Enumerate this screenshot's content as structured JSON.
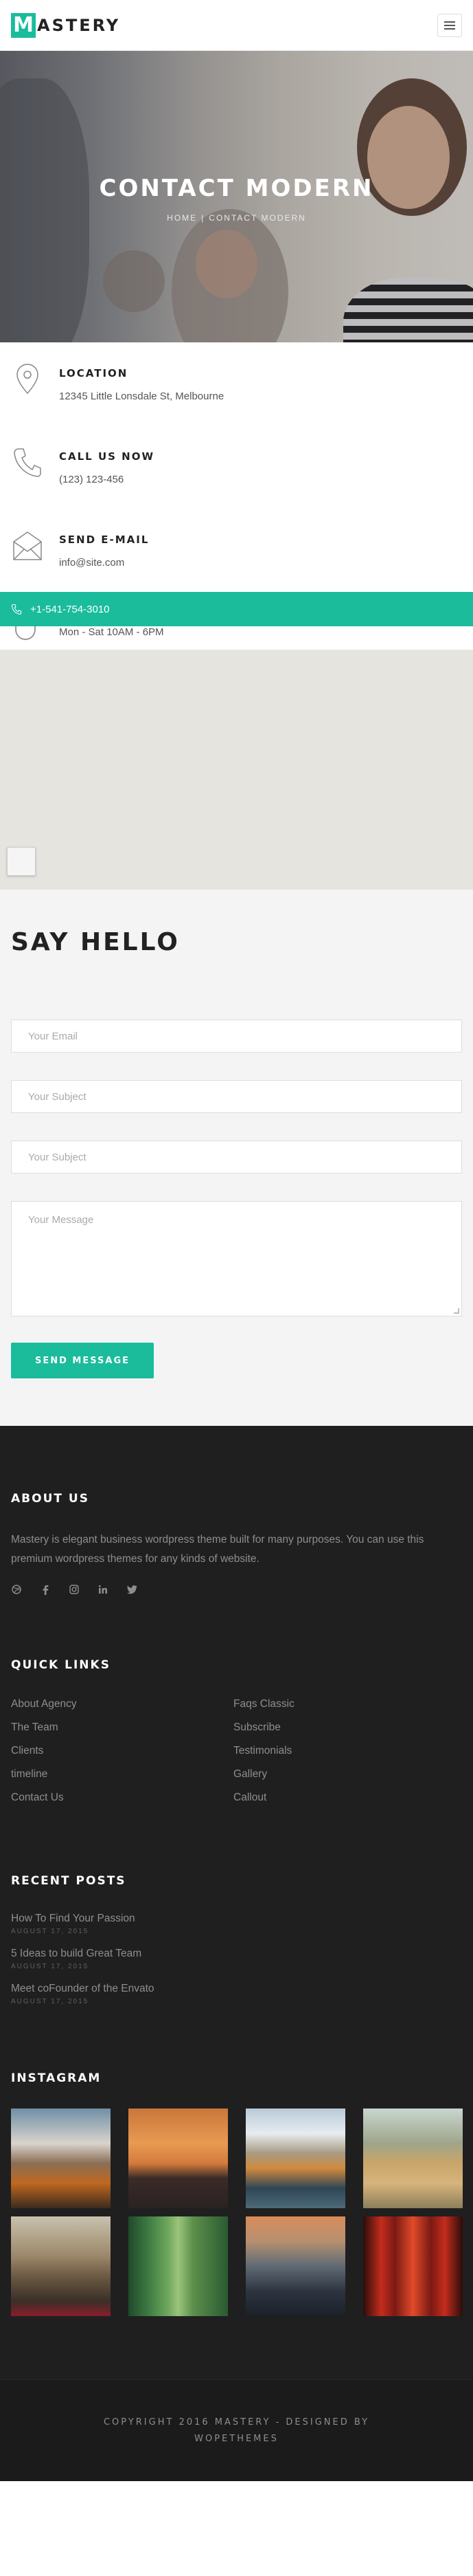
{
  "header": {
    "logo_letter": "M",
    "logo_text": "ASTERY",
    "menu_icon": "hamburger-icon"
  },
  "hero": {
    "title": "CONTACT MODERN",
    "crumb_home": "HOME",
    "crumb_sep": "|",
    "crumb_current": "CONTACT MODERN"
  },
  "contact": {
    "items": [
      {
        "icon": "location-pin-icon",
        "title": "LOCATION",
        "text": "12345 Little Lonsdale St, Melbourne"
      },
      {
        "icon": "phone-icon",
        "title": "CALL US NOW",
        "text": "(123) 123-456"
      },
      {
        "icon": "envelope-icon",
        "title": "SEND E-MAIL",
        "text": "info@site.com"
      }
    ],
    "phone_bar": "+1-541-754-3010",
    "hours": "Mon - Sat 10AM - 6PM"
  },
  "form": {
    "heading": "SAY HELLO",
    "email_placeholder": "Your Email",
    "subject_placeholder": "Your Subject",
    "subject2_placeholder": "Your Subject",
    "message_placeholder": "Your Message",
    "send_label": "SEND MESSAGE"
  },
  "footer": {
    "about_heading": "ABOUT US",
    "about_text": "Mastery is elegant business wordpress theme built for many purposes. You can use this premium wordpress themes for any kinds of website.",
    "quick_heading": "QUICK LINKS",
    "links": [
      "About Agency",
      "Faqs Classic",
      "The Team",
      "Subscribe",
      "Clients",
      "Testimonials",
      "timeline",
      "Gallery",
      "Contact Us",
      "Callout"
    ],
    "posts_heading": "RECENT POSTS",
    "posts": [
      {
        "title": "How To Find Your Passion",
        "date": "AUGUST 17, 2015"
      },
      {
        "title": "5 Ideas to build Great Team",
        "date": "AUGUST 17, 2015"
      },
      {
        "title": "Meet coFounder of the Envato",
        "date": "AUGUST 17, 2015"
      }
    ],
    "instagram_heading": "INSTAGRAM",
    "copyright_line1": "COPYRIGHT 2016 MASTERY - DESIGNED BY",
    "copyright_line2": "WOPETHEMES"
  },
  "colors": {
    "accent": "#1abc9c",
    "footer_bg": "#1f1f20"
  }
}
